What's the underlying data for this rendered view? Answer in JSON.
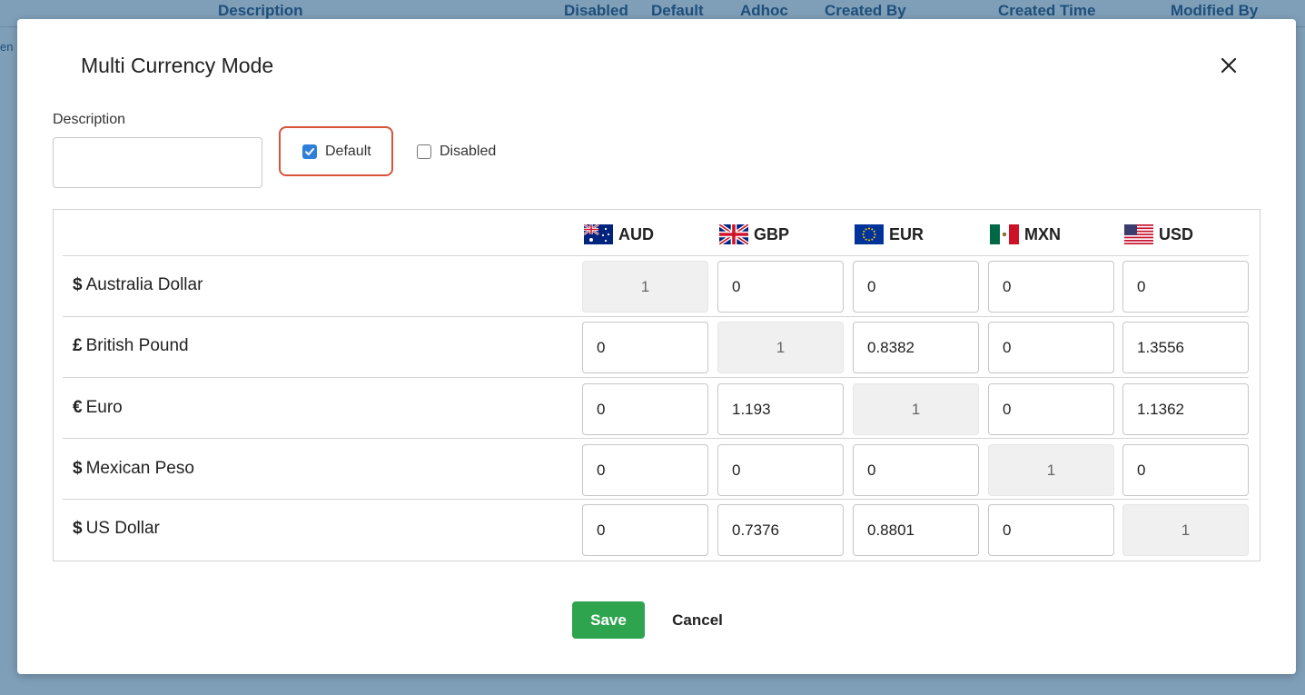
{
  "background_table": {
    "columns": [
      "Description",
      "Disabled",
      "Default",
      "Adhoc",
      "Created By",
      "Created Time",
      "Modified By"
    ],
    "row_stub": "en"
  },
  "modal": {
    "title": "Multi Currency Mode",
    "close_icon": "close-icon",
    "description_label": "Description",
    "description_value": "",
    "default_label": "Default",
    "default_checked": true,
    "disabled_label": "Disabled",
    "disabled_checked": false,
    "currencies": [
      {
        "code": "AUD",
        "flag_icon": "australia-flag-icon"
      },
      {
        "code": "GBP",
        "flag_icon": "uk-flag-icon"
      },
      {
        "code": "EUR",
        "flag_icon": "eu-flag-icon"
      },
      {
        "code": "MXN",
        "flag_icon": "mexico-flag-icon"
      },
      {
        "code": "USD",
        "flag_icon": "usa-flag-icon"
      }
    ],
    "rows": [
      {
        "symbol": "$",
        "name": "Australia Dollar",
        "values": [
          "1",
          "0",
          "0",
          "0",
          "0"
        ]
      },
      {
        "symbol": "£",
        "name": "British Pound",
        "values": [
          "0",
          "1",
          "0.8382",
          "0",
          "1.3556"
        ]
      },
      {
        "symbol": "€",
        "name": "Euro",
        "values": [
          "0",
          "1.193",
          "1",
          "0",
          "1.1362"
        ]
      },
      {
        "symbol": "$",
        "name": "Mexican Peso",
        "values": [
          "0",
          "0",
          "0",
          "1",
          "0"
        ]
      },
      {
        "symbol": "$",
        "name": "US Dollar",
        "values": [
          "0",
          "0.7376",
          "0.8801",
          "0",
          "1"
        ]
      }
    ],
    "save_label": "Save",
    "cancel_label": "Cancel",
    "colors": {
      "save": "#2ea44f",
      "checkbox": "#2f7fd8",
      "highlight": "#d8533a"
    }
  }
}
